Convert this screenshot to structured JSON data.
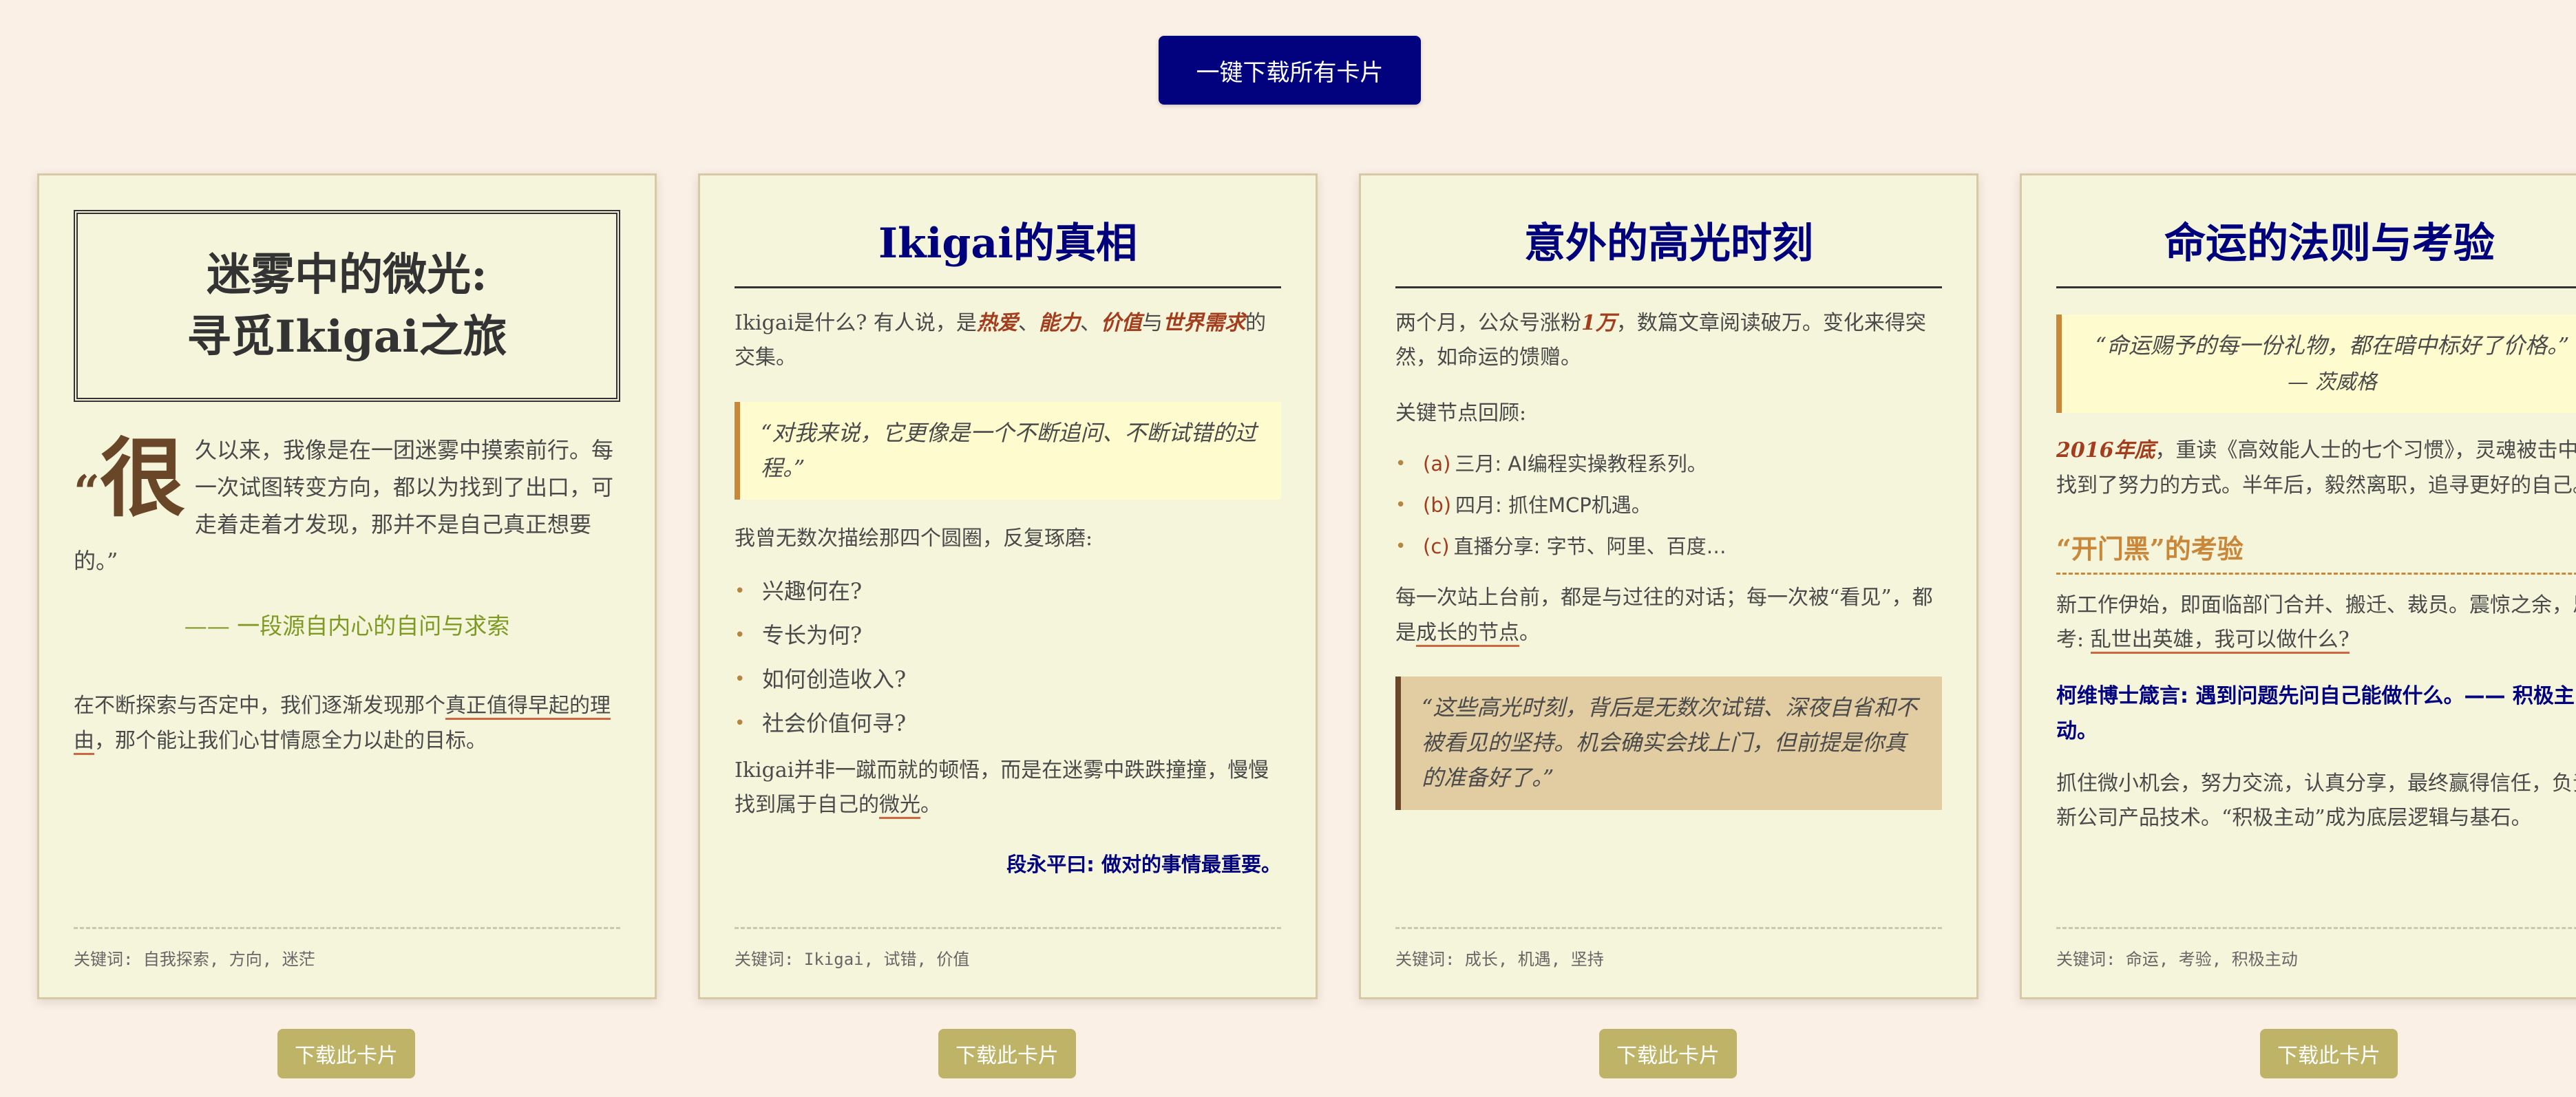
{
  "download_all_label": "一键下载所有卡片",
  "download_card_label": "下载此卡片",
  "colors": {
    "navy": "#02027f",
    "card_bg": "#f5f5dc",
    "page_bg": "#fbf0e6",
    "accent_red": "#a23d1e",
    "accent_gold": "#c9873a",
    "button_olive": "#bfb368",
    "signature_green": "#7e9a24"
  },
  "card1": {
    "title_line1": "迷雾中的微光:",
    "title_line2": "寻觅Ikigai之旅",
    "quote_dropcap": "很",
    "quote_open": "“",
    "quote_rest": "久以来，我像是在一团迷雾中摸索前行。每一次试图转变方向，都以为找到了出口，可走着走着才发现，那并不是自己真正想要的。”",
    "signature": "—— 一段源自内心的自问与求索",
    "body_before": "在不断探索与否定中，我们逐渐发现那个",
    "body_highlight": "真正值得早起的理由",
    "body_after": "，那个能让我们心甘情愿全力以赴的目标。",
    "keywords": "关键词: 自我探索, 方向, 迷茫"
  },
  "card2": {
    "title": "Ikigai的真相",
    "intro_before": "Ikigai是什么? 有人说，是",
    "intro_k1": "热爱",
    "intro_sep1": "、",
    "intro_k2": "能力",
    "intro_sep2": "、",
    "intro_k3": "价值",
    "intro_sep3": "与",
    "intro_k4": "世界需求",
    "intro_after": "的交集。",
    "quote": "“对我来说，它更像是一个不断追问、不断试错的过程。”",
    "list_intro": "我曾无数次描绘那四个圆圈，反复琢磨:",
    "list": [
      "兴趣何在?",
      "专长为何?",
      "如何创造收入?",
      "社会价值何寻?"
    ],
    "closing_before": "Ikigai并非一蹴而就的顿悟，而是在迷雾中跌跌撞撞，慢慢找到属于自己的",
    "closing_highlight": "微光",
    "closing_after": "。",
    "saying": "段永平曰: 做对的事情最重要。",
    "keywords": "关键词: Ikigai, 试错, 价值"
  },
  "card3": {
    "title": "意外的高光时刻",
    "intro_before": "两个月，公众号涨粉",
    "intro_highlight": "1万",
    "intro_after": "，数篇文章阅读破万。变化来得突然，如命运的馈赠。",
    "nodes_label": "关键节点回顾:",
    "nodes": [
      {
        "label": "(a)",
        "text": "三月: AI编程实操教程系列。"
      },
      {
        "label": "(b)",
        "text": "四月: 抓住MCP机遇。"
      },
      {
        "label": "(c)",
        "text": "直播分享: 字节、阿里、百度…"
      }
    ],
    "body_before": "每一次站上台前，都是与过往的对话；每一次被“看见”，都是",
    "body_highlight": "成长的节点",
    "body_after": "。",
    "quote": "“这些高光时刻，背后是无数次试错、深夜自省和不被看见的坚持。机会确实会找上门，但前提是你真的准备好了。”",
    "keywords": "关键词: 成长, 机遇, 坚持"
  },
  "card4": {
    "title": "命运的法则与考验",
    "quote": "“命运赐予的每一份礼物，都在暗中标好了价格。”",
    "quote_author": "— 茨威格",
    "intro_highlight": "2016年底",
    "intro_after": "，重读《高效能人士的七个习惯》，灵魂被击中，找到了努力的方式。半年后，毅然离职，追寻更好的自己。",
    "subheading": "“开门黑”的考验",
    "body1_before": "新工作伊始，即面临部门合并、搬迁、裁员。震惊之余，思考: ",
    "body1_highlight": "乱世出英雄，我可以做什么?",
    "covey": "柯维博士箴言: 遇到问题先问自己能做什么。—— 积极主动。",
    "body2": "抓住微小机会，努力交流，认真分享，最终赢得信任，负责新公司产品技术。“积极主动”成为底层逻辑与基石。",
    "keywords": "关键词: 命运, 考验, 积极主动"
  }
}
